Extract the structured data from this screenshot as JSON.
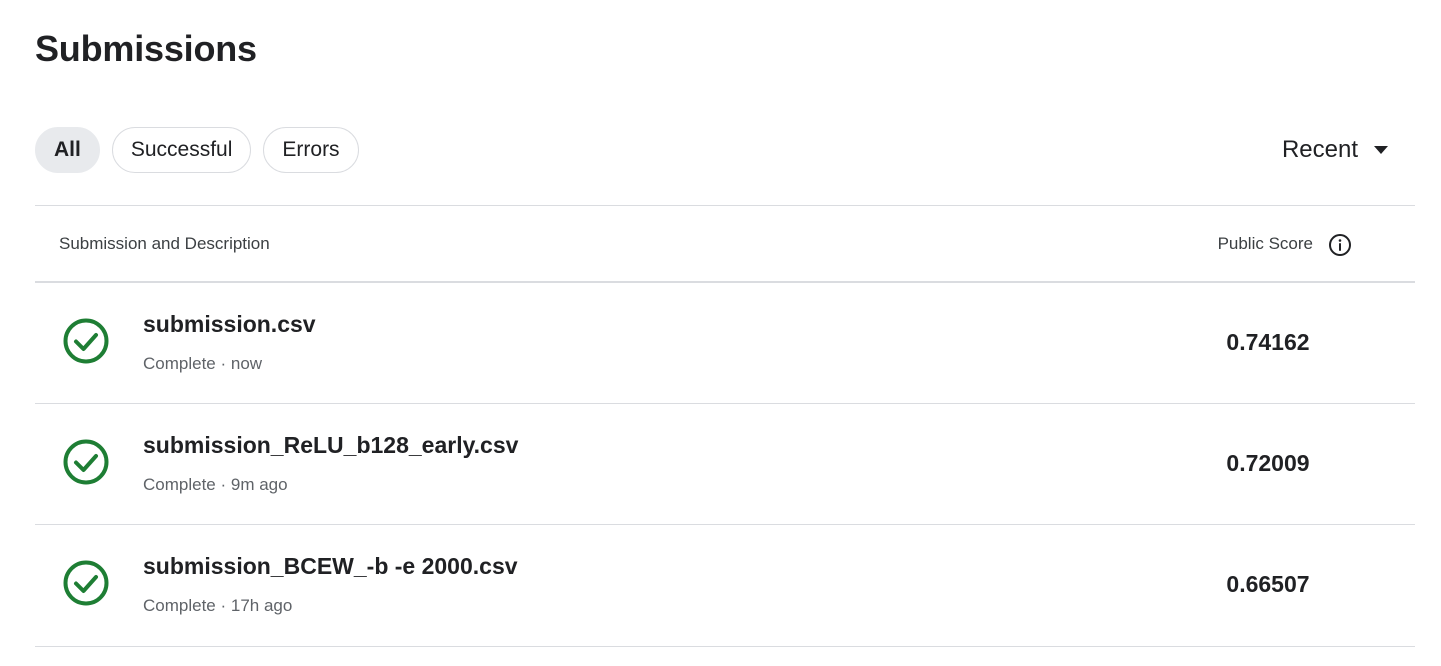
{
  "page": {
    "title": "Submissions"
  },
  "filters": [
    {
      "label": "All",
      "active": true
    },
    {
      "label": "Successful",
      "active": false
    },
    {
      "label": "Errors",
      "active": false
    }
  ],
  "sort": {
    "label": "Recent",
    "icon": "caret-down-icon"
  },
  "table": {
    "headers": {
      "description": "Submission and Description",
      "score": "Public Score",
      "score_icon": "info-icon"
    },
    "rows": [
      {
        "name": "submission.csv",
        "status": "Complete",
        "time": "now",
        "meta": "Complete · now",
        "score": "0.74162",
        "status_icon": "check-circle-icon"
      },
      {
        "name": "submission_ReLU_b128_early.csv",
        "status": "Complete",
        "time": "9m ago",
        "meta": "Complete · 9m ago",
        "score": "0.72009",
        "status_icon": "check-circle-icon"
      },
      {
        "name": "submission_BCEW_-b -e 2000.csv",
        "status": "Complete",
        "time": "17h ago",
        "meta": "Complete · 17h ago",
        "score": "0.66507",
        "status_icon": "check-circle-icon"
      }
    ]
  },
  "colors": {
    "success": "#1e7e34",
    "text": "#202124",
    "muted": "#5f6368",
    "border": "#dadce0",
    "chip_active_bg": "#e8eaed"
  }
}
